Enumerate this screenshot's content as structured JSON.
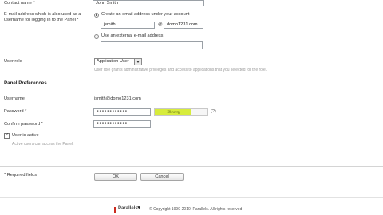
{
  "contact": {
    "label": "Contact name *",
    "value": "John Smith"
  },
  "email": {
    "label_line1": "E-mail address which is also used as a",
    "label_line2": "username for logging in to the Panel *",
    "option_create_label": "Create an email address under your account",
    "local_part": "jsmith",
    "at_symbol": "@",
    "domain": "domo1231.com",
    "option_external_label": "Use an external e-mail address",
    "external_value": ""
  },
  "user_role": {
    "label": "User role",
    "selected": "Application User",
    "hint": "User role grants administrative privileges and access to applications that you selected for the role."
  },
  "panel_preferences": {
    "heading": "Panel Preferences",
    "username_label": "Username",
    "username_value": "jsmith@domo1231.com",
    "password_label": "Password *",
    "password_value": "●●●●●●●●●●●●",
    "strength_label": "Strong",
    "strength_level": 0.7,
    "help_icon_text": "(?)",
    "confirm_label": "Confirm password *",
    "confirm_value": "●●●●●●●●●●●●",
    "active_label": "User is active",
    "active_checked": true,
    "active_hint": "Active users can access the Panel."
  },
  "form": {
    "required_note": "* Required fields",
    "ok_label": "OK",
    "cancel_label": "Cancel"
  },
  "footer": {
    "brand": "Parallels",
    "copyright": "© Copyright 1999-2010, Parallels. All rights reserved"
  },
  "colors": {
    "strength_fill": "#d7ec3c",
    "brand_red": "#cc2a1e"
  }
}
